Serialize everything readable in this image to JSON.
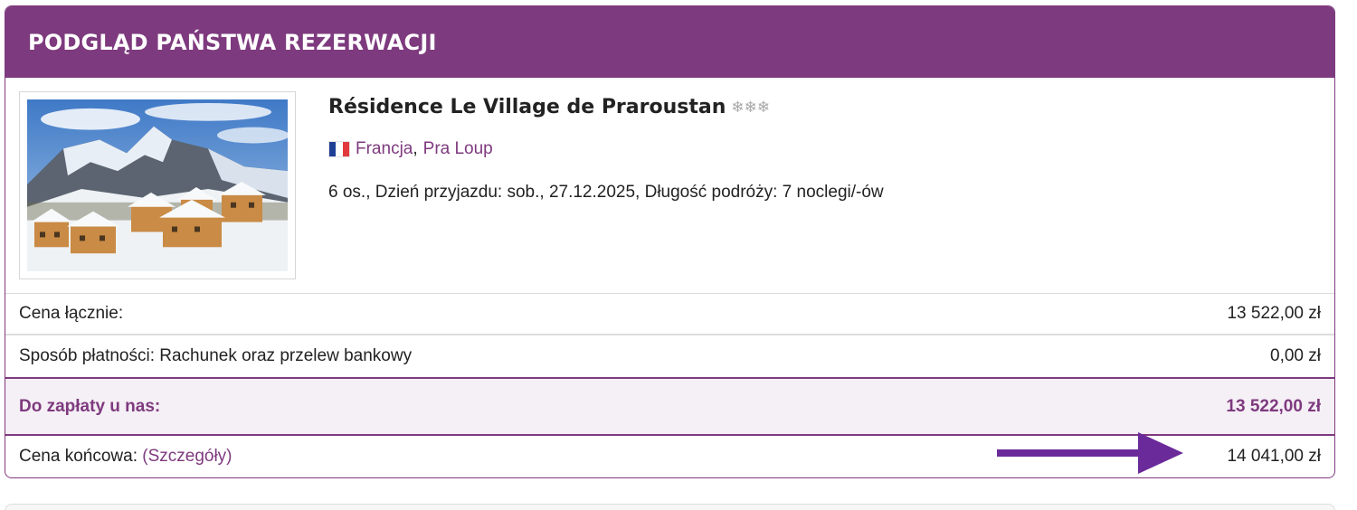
{
  "header": {
    "title": "PODGLĄD PAŃSTWA REZERWACJI"
  },
  "hotel": {
    "name": "Résidence Le Village de Praroustan",
    "stars_text": "❄❄❄",
    "rating": 3,
    "country": "Francja",
    "separator": ",",
    "resort": "Pra Loup",
    "flag_colors": [
      "#1f3f95",
      "#ffffff",
      "#e2393e"
    ],
    "trip_info": "6 os., Dzień przyjazdu: sob., 27.12.2025, Długość podróży: 7 noclegi/-ów"
  },
  "price_rows": [
    {
      "label": "Cena łącznie:",
      "value": "13 522,00 zł"
    },
    {
      "label": "Sposób płatności: Rachunek oraz przelew bankowy",
      "value": "0,00 zł"
    }
  ],
  "total": {
    "label": "Do zapłaty u nas:",
    "value": "13 522,00 zł"
  },
  "final": {
    "label": "Cena końcowa:",
    "link": "(Szczegóły)",
    "value": "14 041,00 zł"
  },
  "colors": {
    "accent": "#7e3a7e",
    "total_bg": "#f5eff6",
    "arrow": "#6b2a9a"
  }
}
